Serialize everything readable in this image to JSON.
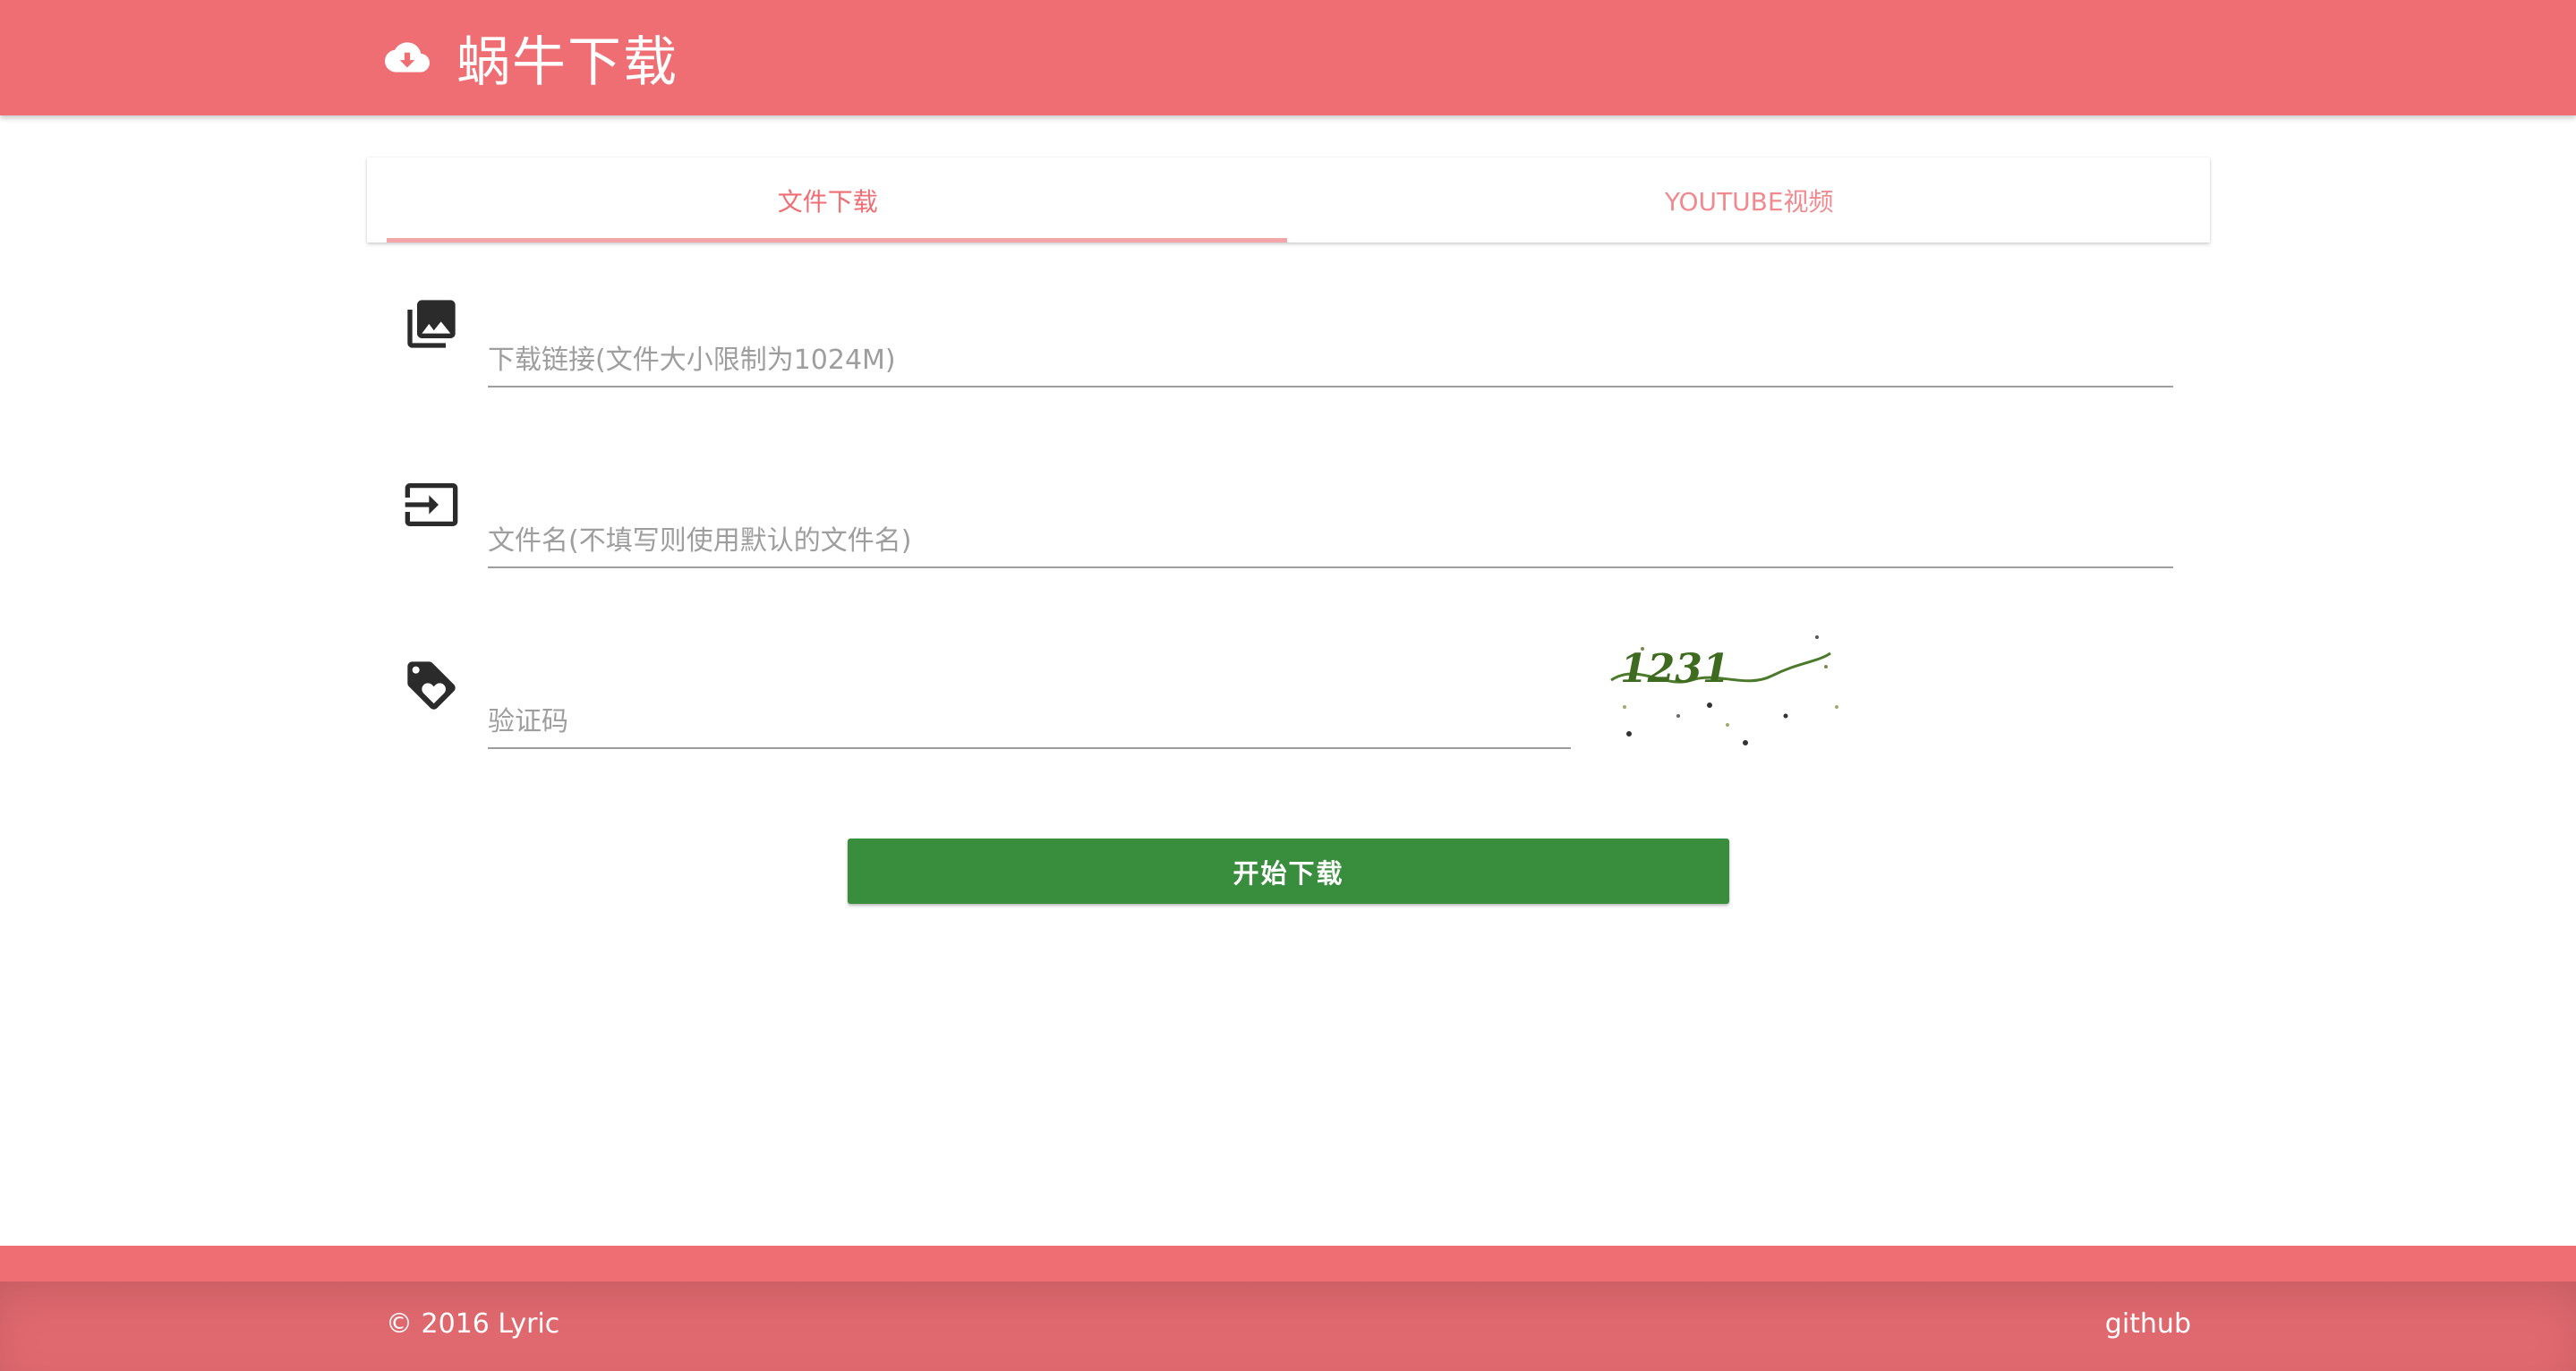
{
  "header": {
    "icon": "cloud-download-icon",
    "title": "蜗牛下载"
  },
  "tabs": [
    {
      "label": "文件下载",
      "active": true
    },
    {
      "label": "YOUTUBE视频",
      "active": false
    }
  ],
  "form": {
    "url_field": {
      "icon": "photo-library-icon",
      "placeholder": "下载链接(文件大小限制为1024M)",
      "value": ""
    },
    "filename_field": {
      "icon": "input-icon",
      "placeholder": "文件名(不填写则使用默认的文件名)",
      "value": ""
    },
    "captcha_field": {
      "icon": "loyalty-tag-icon",
      "placeholder": "验证码",
      "value": ""
    },
    "captcha_image_text": "1231",
    "submit_label": "开始下载"
  },
  "footer": {
    "copyright": "© 2016 Lyric",
    "link_label": "github"
  },
  "colors": {
    "primary": "#ef6e74",
    "footer": "#e0696f",
    "button": "#388e3c"
  }
}
